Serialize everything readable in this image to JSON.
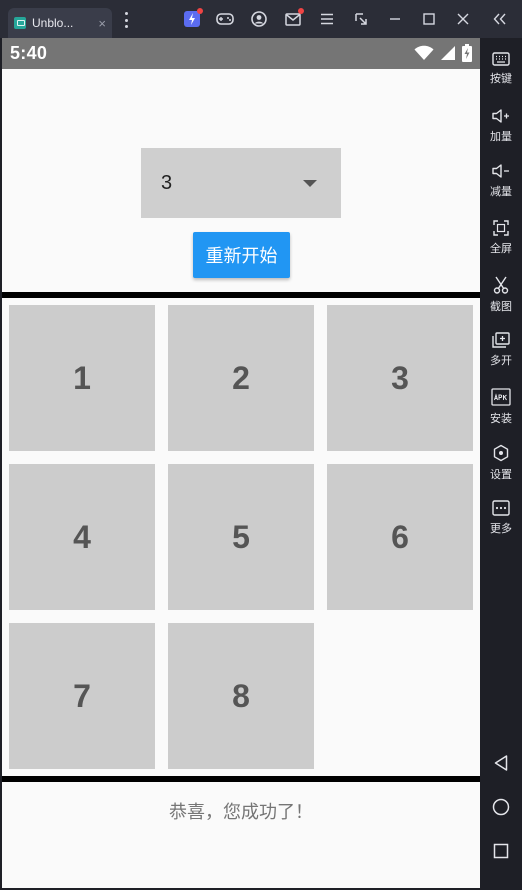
{
  "window": {
    "tab_title": "Unblo...",
    "tab_close": "×"
  },
  "status_bar": {
    "time": "5:40"
  },
  "controls": {
    "size_select": {
      "value": "3"
    },
    "restart_label": "重新开始"
  },
  "board": {
    "tiles": [
      "1",
      "2",
      "3",
      "4",
      "5",
      "6",
      "7",
      "8"
    ]
  },
  "message": "恭喜，您成功了！",
  "sidebar": {
    "items": [
      {
        "label": "按键",
        "icon": "keyboard-icon"
      },
      {
        "label": "加量",
        "icon": "volume-up-icon"
      },
      {
        "label": "减量",
        "icon": "volume-down-icon"
      },
      {
        "label": "全屏",
        "icon": "fullscreen-icon"
      },
      {
        "label": "截图",
        "icon": "scissors-icon"
      },
      {
        "label": "多开",
        "icon": "multi-instance-icon"
      },
      {
        "label": "安装",
        "icon": "apk-icon"
      },
      {
        "label": "设置",
        "icon": "settings-icon"
      },
      {
        "label": "更多",
        "icon": "more-icon"
      }
    ]
  },
  "colors": {
    "accent": "#2196f3",
    "tile": "#cccccc",
    "status_bar": "#757575",
    "chrome": "#2b2d37"
  }
}
